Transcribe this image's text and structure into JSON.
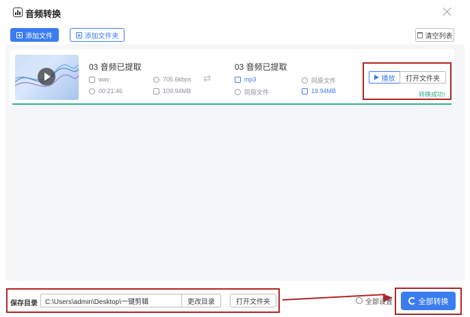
{
  "window": {
    "title": "音频转换"
  },
  "toolbar": {
    "add_file": "添加文件",
    "add_folder": "添加文件夹",
    "clear_list": "清空列表"
  },
  "file_item": {
    "source": {
      "name": "03 音频已提取",
      "format": "wav",
      "bitrate": "705.6kbps",
      "duration": "00:21:46",
      "size": "109.94MB"
    },
    "target": {
      "name": "03 音频已提取",
      "format": "mp3",
      "bitrate": "同原文件",
      "duration": "同原文件",
      "size": "19.94MB"
    },
    "actions": {
      "play": "播放",
      "open_folder": "打开文件夹"
    },
    "status": "转换成功!",
    "progress": 1.0
  },
  "footer": {
    "save_dir_label": "保存目录",
    "save_dir_value": "C:\\Users\\admin\\Desktop\\一键剪辑",
    "change_dir": "更改目录",
    "open_folder": "打开文件夹",
    "all_settings": "全部设置",
    "convert_all": "全部转换"
  },
  "colors": {
    "accent": "#3b7cf0",
    "success": "#2aae8a",
    "annotation": "#b22222"
  }
}
